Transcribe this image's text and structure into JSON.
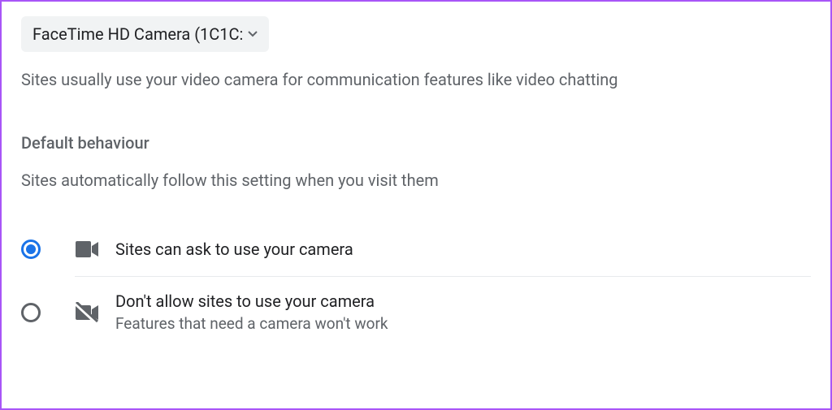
{
  "camera_select": {
    "label": "FaceTime HD Camera (1C1C:"
  },
  "description": "Sites usually use your video camera for communication features like video chatting",
  "default_behaviour": {
    "heading": "Default behaviour",
    "subtext": "Sites automatically follow this setting when you visit them"
  },
  "options": {
    "allow": {
      "title": "Sites can ask to use your camera"
    },
    "block": {
      "title": "Don't allow sites to use your camera",
      "subtitle": "Features that need a camera won't work"
    }
  }
}
